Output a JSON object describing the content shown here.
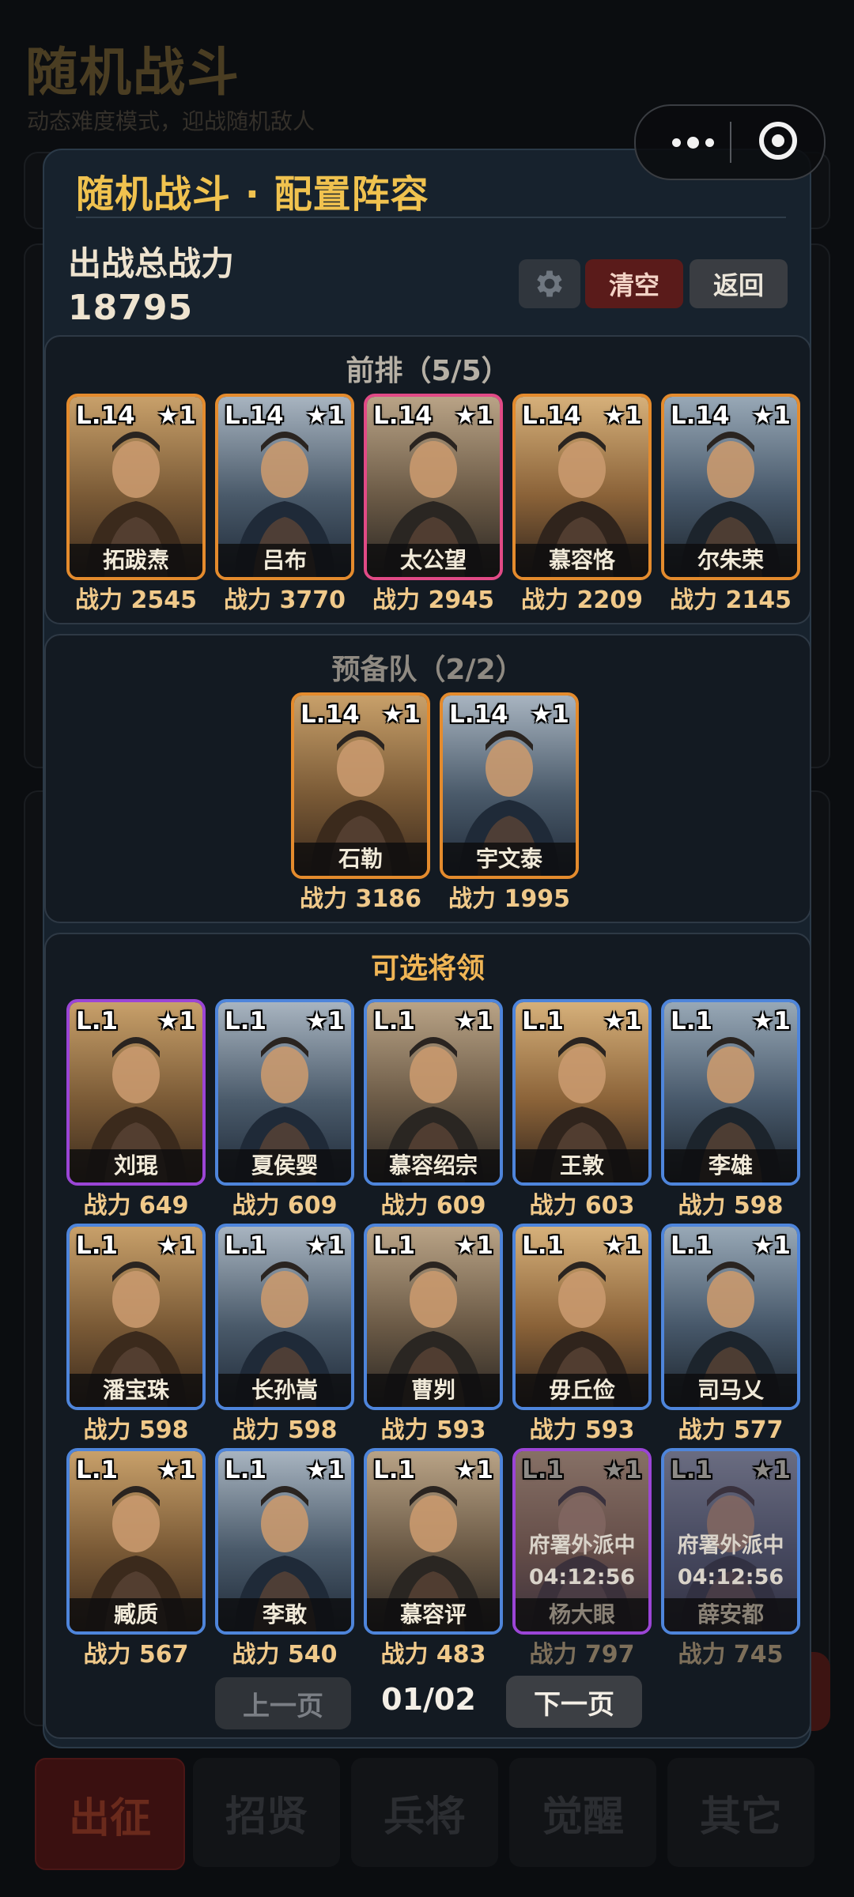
{
  "background": {
    "title": "随机战斗",
    "subtitle": "动态难度模式，迎战随机敌人",
    "nav": [
      "出征",
      "招贤",
      "兵将",
      "觉醒",
      "其它"
    ]
  },
  "modal": {
    "title": "随机战斗 · 配置阵容",
    "power_label": "出战总战力",
    "power_value": "18795",
    "gear_icon": "gear-icon",
    "clear_label": "清空",
    "back_label": "返回",
    "front_title": "前排（5/5）",
    "reserve_title": "预备队（2/2）",
    "available_title": "可选将领",
    "prev_label": "上一页",
    "next_label": "下一页",
    "page_indicator": "01/02"
  },
  "colors": {
    "accent": "#f0c24f",
    "orange_border": "#e48b2d",
    "blue_border": "#4e85db",
    "purple_border": "#9b45d6",
    "pink_border": "#e14a86"
  },
  "front": [
    {
      "level": "L.14",
      "star": "★1",
      "name": "拓跋焘",
      "power": "战力 2545"
    },
    {
      "level": "L.14",
      "star": "★1",
      "name": "吕布",
      "power": "战力 3770"
    },
    {
      "level": "L.14",
      "star": "★1",
      "name": "太公望",
      "power": "战力 2945"
    },
    {
      "level": "L.14",
      "star": "★1",
      "name": "慕容恪",
      "power": "战力 2209"
    },
    {
      "level": "L.14",
      "star": "★1",
      "name": "尔朱荣",
      "power": "战力 2145"
    }
  ],
  "reserve": [
    {
      "level": "L.14",
      "star": "★1",
      "name": "石勒",
      "power": "战力 3186"
    },
    {
      "level": "L.14",
      "star": "★1",
      "name": "宇文泰",
      "power": "战力 1995"
    }
  ],
  "available": [
    {
      "level": "L.1",
      "star": "★1",
      "name": "刘琨",
      "power": "战力 649"
    },
    {
      "level": "L.1",
      "star": "★1",
      "name": "夏侯婴",
      "power": "战力 609"
    },
    {
      "level": "L.1",
      "star": "★1",
      "name": "慕容绍宗",
      "power": "战力 609"
    },
    {
      "level": "L.1",
      "star": "★1",
      "name": "王敦",
      "power": "战力 603"
    },
    {
      "level": "L.1",
      "star": "★1",
      "name": "李雄",
      "power": "战力 598"
    },
    {
      "level": "L.1",
      "star": "★1",
      "name": "潘宝珠",
      "power": "战力 598"
    },
    {
      "level": "L.1",
      "star": "★1",
      "name": "长孙嵩",
      "power": "战力 598"
    },
    {
      "level": "L.1",
      "star": "★1",
      "name": "曹刿",
      "power": "战力 593"
    },
    {
      "level": "L.1",
      "star": "★1",
      "name": "毋丘俭",
      "power": "战力 593"
    },
    {
      "level": "L.1",
      "star": "★1",
      "name": "司马乂",
      "power": "战力 577"
    },
    {
      "level": "L.1",
      "star": "★1",
      "name": "臧质",
      "power": "战力 567"
    },
    {
      "level": "L.1",
      "star": "★1",
      "name": "李敢",
      "power": "战力 540"
    },
    {
      "level": "L.1",
      "star": "★1",
      "name": "慕容评",
      "power": "战力 483"
    },
    {
      "level": "L.1",
      "star": "★1",
      "name": "杨大眼",
      "power": "战力 797",
      "status": "府署外派中",
      "timer": "04:12:56"
    },
    {
      "level": "L.1",
      "star": "★1",
      "name": "薛安都",
      "power": "战力 745",
      "status": "府署外派中",
      "timer": "04:12:56"
    }
  ]
}
